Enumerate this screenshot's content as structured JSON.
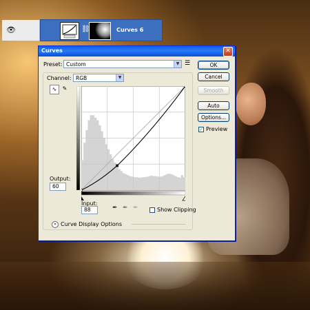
{
  "layer": {
    "name": "Curves 6",
    "eye_icon": "eye-icon",
    "adjustment_icon": "curves-adjustment-icon",
    "link_icon": "chain-link-icon",
    "mask_icon": "layer-mask-thumbnail"
  },
  "dialog": {
    "title": "Curves",
    "close_icon": "close-icon",
    "preset_label": "Preset:",
    "preset_value": "Custom",
    "preset_menu_icon": "preset-options-icon",
    "channel_label": "Channel:",
    "channel_value": "RGB",
    "buttons": {
      "ok": "OK",
      "cancel": "Cancel",
      "smooth": "Smooth",
      "auto": "Auto",
      "options": "Options..."
    },
    "preview_label": "Preview",
    "preview_checked": true,
    "output_label": "Output:",
    "output_value": "60",
    "input_label": "Input:",
    "input_value": "88",
    "show_clipping_label": "Show Clipping",
    "show_clipping_checked": false,
    "curve_display_options_label": "Curve Display Options",
    "tools": [
      "curve-point-tool-icon",
      "pencil-tool-icon"
    ],
    "eyedroppers": [
      "black-eyedropper-icon",
      "gray-eyedropper-icon",
      "white-eyedropper-icon"
    ]
  },
  "colors": {
    "titlebar": "#0a5fef",
    "dialog_bg": "#ece9d8",
    "layer_highlight": "#3d6fc0",
    "close_button": "#c2391b"
  },
  "chart_data": {
    "type": "line",
    "xlim": [
      0,
      255
    ],
    "ylim": [
      0,
      255
    ],
    "grid": true,
    "series": [
      {
        "x": [
          0,
          88,
          255
        ],
        "y": [
          0,
          60,
          255
        ]
      }
    ],
    "control_points": [
      [
        0,
        0
      ],
      [
        88,
        60
      ],
      [
        255,
        255
      ]
    ],
    "histogram_estimate": [
      60,
      95,
      120,
      140,
      150,
      150,
      145,
      140,
      130,
      118,
      105,
      92,
      82,
      72,
      62,
      55,
      48,
      42,
      38,
      34,
      32,
      30,
      28,
      27,
      26,
      26,
      25,
      25,
      26,
      26,
      27,
      28,
      29,
      28,
      28,
      27,
      27,
      28,
      30,
      32,
      33,
      32,
      30,
      28,
      26,
      25,
      30,
      26
    ]
  }
}
